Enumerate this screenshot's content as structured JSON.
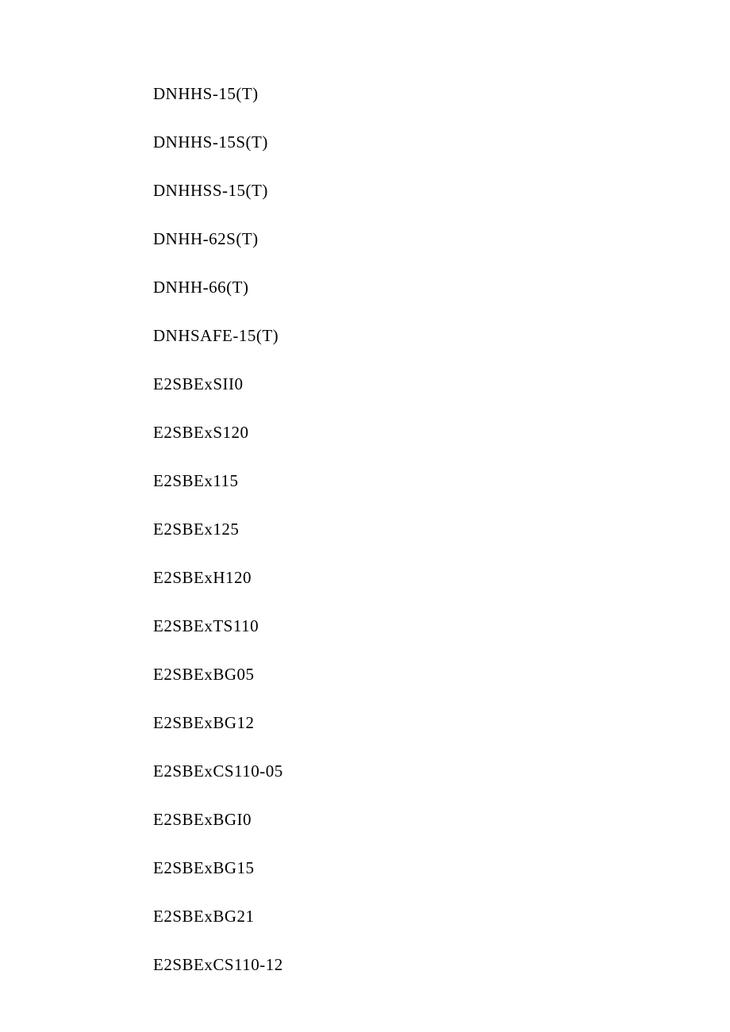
{
  "items": [
    "DNHHS-15(T)",
    "DNHHS-15S(T)",
    "DNHHSS-15(T)",
    "DNHH-62S(T)",
    "DNHH-66(T)",
    "DNHSAFE-15(T)",
    "E2SBExSII0",
    "E2SBExS120",
    "E2SBEx115",
    "E2SBEx125",
    "E2SBExH120",
    "E2SBExTS110",
    "E2SBExBG05",
    "E2SBExBG12",
    "E2SBExCS110-05",
    "E2SBExBGI0",
    "E2SBExBG15",
    "E2SBExBG21",
    "E2SBExCS110-12"
  ]
}
